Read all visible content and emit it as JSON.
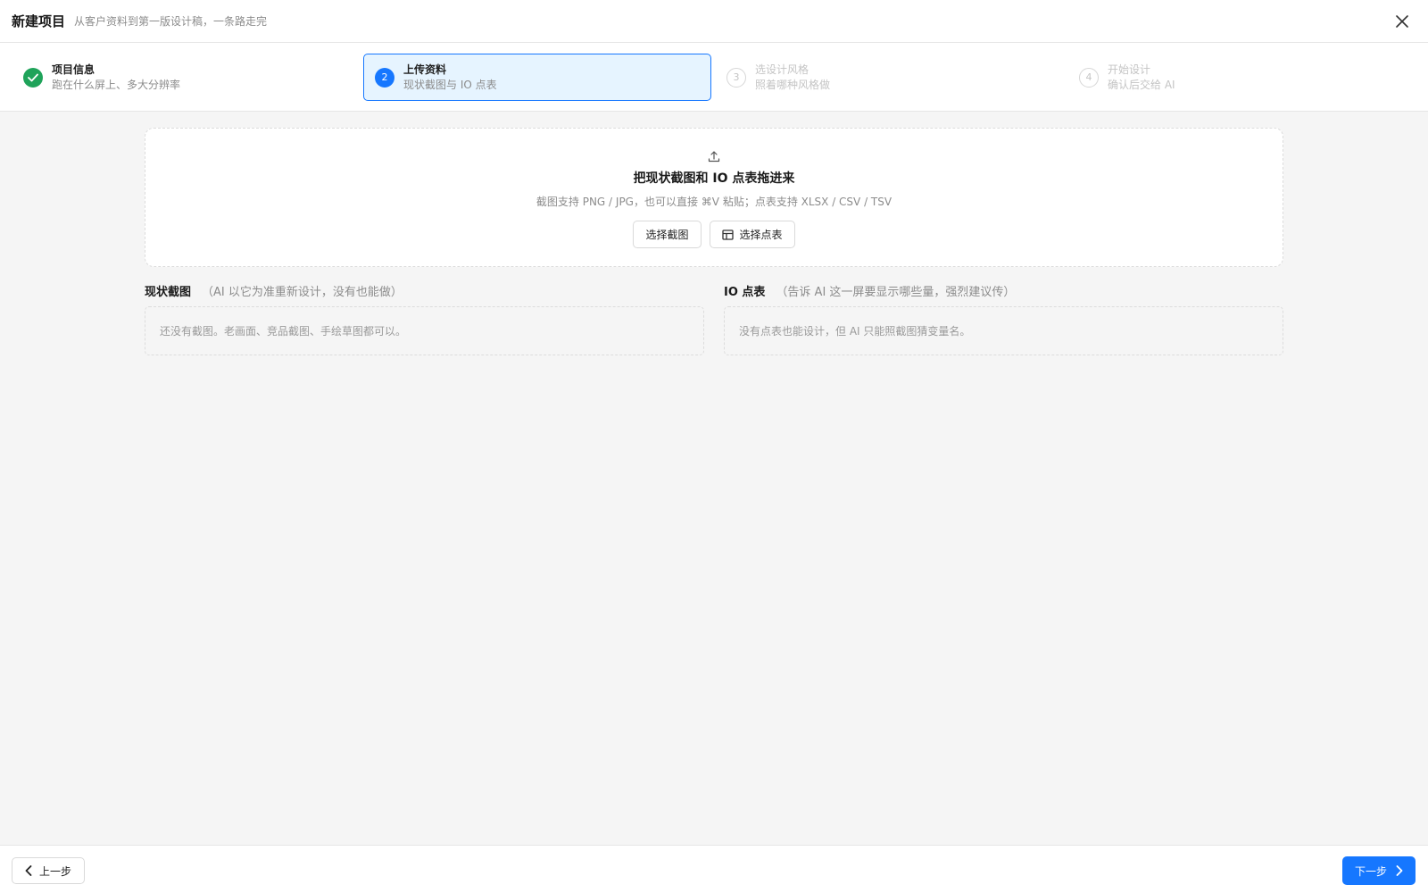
{
  "header": {
    "title": "新建项目",
    "subtitle": "从客户资料到第一版设计稿，一条路走完"
  },
  "steps": [
    {
      "number": "1",
      "label": "项目信息",
      "desc": "跑在什么屏上、多大分辨率",
      "state": "done"
    },
    {
      "number": "2",
      "label": "上传资料",
      "desc": "现状截图与 IO 点表",
      "state": "current"
    },
    {
      "number": "3",
      "label": "选设计风格",
      "desc": "照着哪种风格做",
      "state": "pending"
    },
    {
      "number": "4",
      "label": "开始设计",
      "desc": "确认后交给 AI",
      "state": "pending"
    }
  ],
  "dropzone": {
    "title": "把现状截图和 IO 点表拖进来",
    "desc": "截图支持 PNG / JPG，也可以直接 ⌘V 粘贴；点表支持 XLSX / CSV / TSV",
    "choose_screenshot": "选择截图",
    "choose_table": "选择点表"
  },
  "screenshots": {
    "title": "现状截图",
    "note": "（AI 以它为准重新设计，没有也能做）",
    "empty": "还没有截图。老画面、竞品截图、手绘草图都可以。"
  },
  "io_table": {
    "title": "IO 点表",
    "note": "（告诉 AI 这一屏要显示哪些量，强烈建议传）",
    "empty": "没有点表也能设计，但 AI 只能照截图猜变量名。"
  },
  "footer": {
    "prev": "上一步",
    "next": "下一步"
  },
  "colors": {
    "accent": "#1677ff",
    "done": "#1fa35a",
    "active_bg": "#e6f4ff"
  }
}
